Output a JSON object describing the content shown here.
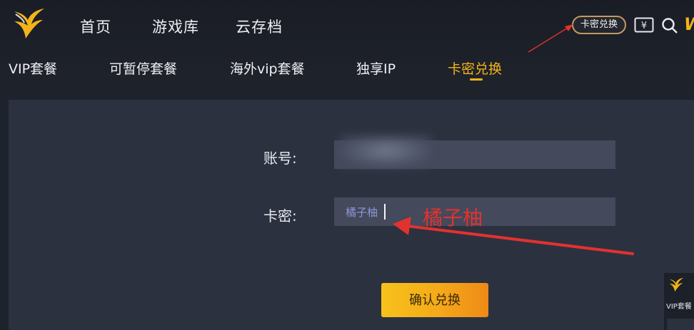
{
  "nav": {
    "main": [
      "首页",
      "游戏库",
      "云存档"
    ],
    "tabs": [
      "VIP套餐",
      "可暂停套餐",
      "海外vip套餐",
      "独享IP",
      "卡密兑换"
    ],
    "active_tab": "卡密兑换"
  },
  "header_actions": {
    "redeem_pill": "卡密兑换",
    "currency_icon": "yen-ticket-icon",
    "search_icon": "search-icon",
    "partial_glyph": "W"
  },
  "form": {
    "account_label": "账号:",
    "account_value": "",
    "code_label": "卡密:",
    "code_value": "橘子柚",
    "submit_label": "确认兑换"
  },
  "annotation": {
    "text": "橘子柚",
    "color": "#e2322f"
  },
  "mini_app": {
    "tab": "VIP套餐"
  },
  "colors": {
    "accent": "#f3b41a",
    "panel": "#2c313f",
    "input": "#44495c"
  }
}
